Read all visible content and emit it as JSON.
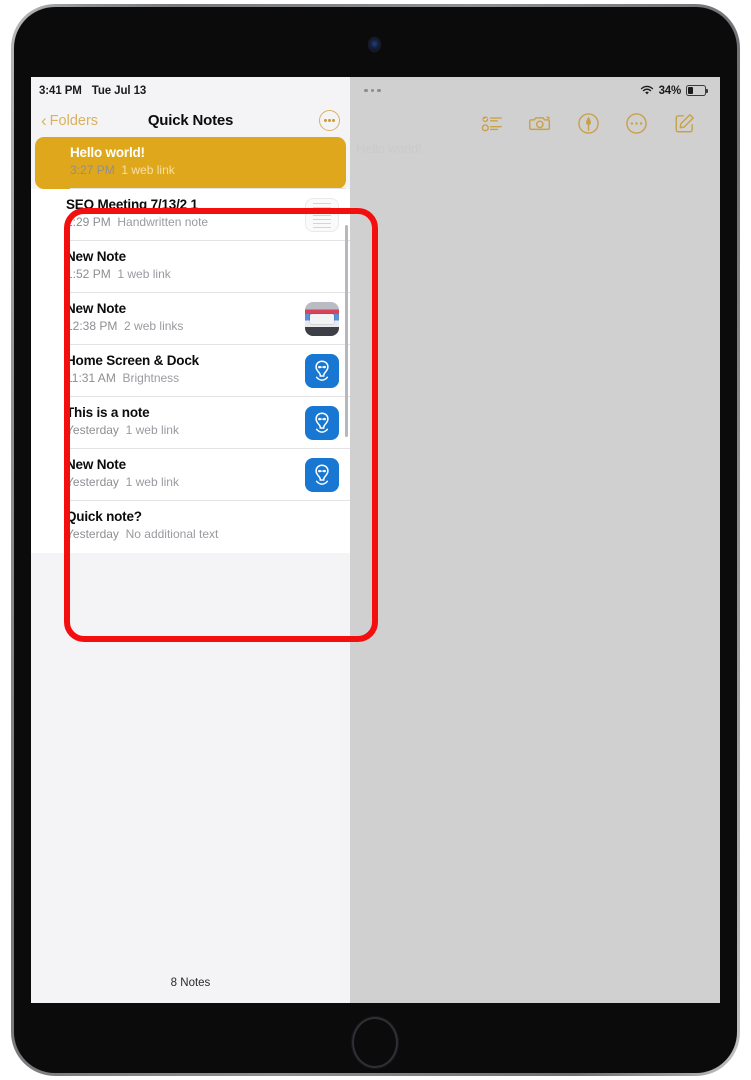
{
  "device": {
    "name": "ipad-tablet"
  },
  "status_bar": {
    "time": "3:41 PM",
    "date": "Tue Jul 13",
    "wifi_icon": "wifi-icon",
    "battery_percent": "34%",
    "battery_icon": "battery-icon",
    "multitask_handle_icon": "multitask-handle-icon"
  },
  "notes_panel": {
    "back_label": "Folders",
    "back_chevron_icon": "chevron-left-icon",
    "title": "Quick Notes",
    "more_button_icon": "ellipsis-circle-icon",
    "footer_count": "8 Notes",
    "notes": [
      {
        "title": "Hello world!",
        "time": "3:27 PM",
        "detail": "1 web link",
        "selected": true,
        "thumb": "none"
      },
      {
        "title": "SEO Meeting 7/13/2 1",
        "time": "2:29 PM",
        "detail": "Handwritten note",
        "selected": false,
        "thumb": "handwritten"
      },
      {
        "title": "New Note",
        "time": "1:52 PM",
        "detail": "1 web link",
        "selected": false,
        "thumb": "none"
      },
      {
        "title": "New Note",
        "time": "12:38 PM",
        "detail": "2 web links",
        "selected": false,
        "thumb": "screenshot"
      },
      {
        "title": "Home Screen & Dock",
        "time": "11:31 AM",
        "detail": "Brightness",
        "selected": false,
        "thumb": "app"
      },
      {
        "title": "This is a note",
        "time": "Yesterday",
        "detail": "1 web link",
        "selected": false,
        "thumb": "app"
      },
      {
        "title": "New Note",
        "time": "Yesterday",
        "detail": "1 web link",
        "selected": false,
        "thumb": "app"
      },
      {
        "title": "Quick note?",
        "time": "Yesterday",
        "detail": "No additional text",
        "selected": false,
        "thumb": "none"
      }
    ]
  },
  "detail_panel": {
    "ghost_title": "Hello world!",
    "toolbar": [
      {
        "icon": "checklist-icon",
        "label": "Checklist"
      },
      {
        "icon": "camera-icon",
        "label": "Camera"
      },
      {
        "icon": "markup-pen-icon",
        "label": "Markup"
      },
      {
        "icon": "ellipsis-circle-icon",
        "label": "More"
      },
      {
        "icon": "compose-icon",
        "label": "New Note"
      }
    ]
  },
  "annotation": {
    "highlight_color": "#f40f0f",
    "label": "note-list-highlight"
  },
  "colors": {
    "accent_gold": "#c9a14a",
    "selected_row": "#dfa81c",
    "panel_bg": "#f4f4f7",
    "detail_bg": "#d0d0d0",
    "app_icon_blue": "#1877d2"
  }
}
